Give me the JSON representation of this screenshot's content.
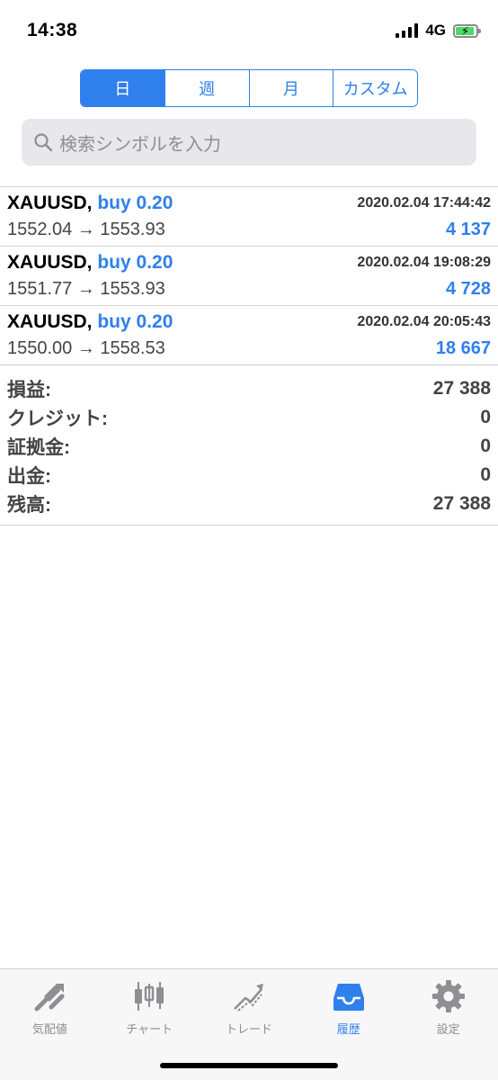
{
  "status": {
    "time": "14:38",
    "network": "4G"
  },
  "segments": [
    "日",
    "週",
    "月",
    "カスタム"
  ],
  "search": {
    "placeholder": "検索シンボルを入力"
  },
  "deals": [
    {
      "symbol": "XAUUSD,",
      "side": "buy 0.20",
      "time": "2020.02.04 17:44:42",
      "prices": "1552.04 → 1553.93",
      "profit": "4 137"
    },
    {
      "symbol": "XAUUSD,",
      "side": "buy 0.20",
      "time": "2020.02.04 19:08:29",
      "prices": "1551.77 → 1553.93",
      "profit": "4 728"
    },
    {
      "symbol": "XAUUSD,",
      "side": "buy 0.20",
      "time": "2020.02.04 20:05:43",
      "prices": "1550.00 → 1558.53",
      "profit": "18 667"
    }
  ],
  "summary": [
    {
      "label": "損益:",
      "value": "27 388"
    },
    {
      "label": "クレジット:",
      "value": "0"
    },
    {
      "label": "証拠金:",
      "value": "0"
    },
    {
      "label": "出金:",
      "value": "0"
    },
    {
      "label": "残高:",
      "value": "27 388"
    }
  ],
  "tabs": [
    {
      "label": "気配値",
      "icon": "quotes-icon"
    },
    {
      "label": "チャート",
      "icon": "chart-icon"
    },
    {
      "label": "トレード",
      "icon": "trade-icon"
    },
    {
      "label": "履歴",
      "icon": "history-icon"
    },
    {
      "label": "設定",
      "icon": "settings-icon"
    }
  ],
  "colors": {
    "accent": "#2f80ec",
    "inactive": "#8e8e93"
  }
}
